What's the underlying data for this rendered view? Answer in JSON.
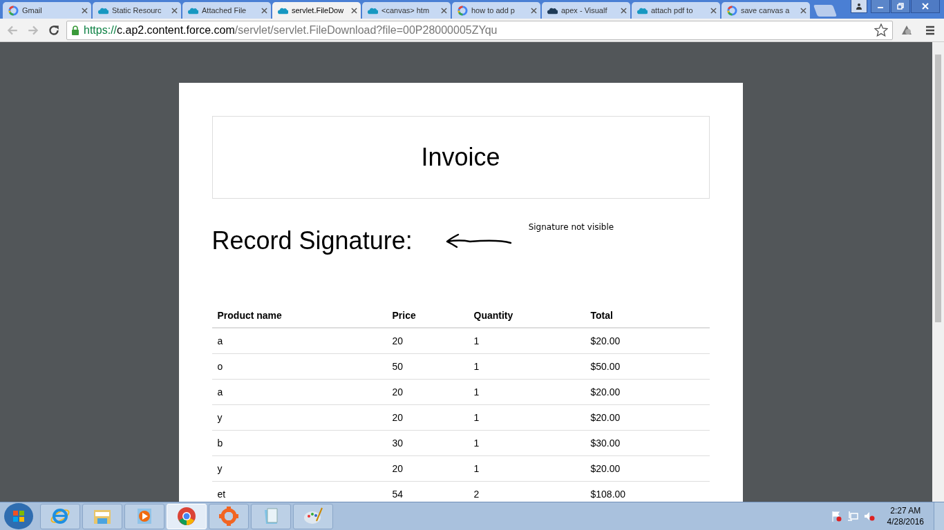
{
  "tabs": [
    {
      "title": "Gmail",
      "kind": "google",
      "selected": false
    },
    {
      "title": "Static Resourc",
      "kind": "salesforce",
      "selected": false
    },
    {
      "title": "Attached File",
      "kind": "salesforce",
      "selected": false
    },
    {
      "title": "servlet.FileDow",
      "kind": "salesforce",
      "selected": true
    },
    {
      "title": "<canvas> htm",
      "kind": "salesforce",
      "selected": false
    },
    {
      "title": "how to add p",
      "kind": "google",
      "selected": false
    },
    {
      "title": "apex - Visualf",
      "kind": "cloud",
      "selected": false
    },
    {
      "title": "attach pdf to",
      "kind": "salesforce",
      "selected": false
    },
    {
      "title": "save canvas a",
      "kind": "google",
      "selected": false
    }
  ],
  "address": {
    "secure_part": "https://",
    "host": "c.ap2.content.force.com",
    "path": "/servlet/servlet.FileDownload?file=00P28000005ZYqu"
  },
  "document": {
    "title": "Invoice",
    "signature_label": "Record Signature:",
    "note": "Signature not visible",
    "table": {
      "columns": [
        "Product name",
        "Price",
        "Quantity",
        "Total"
      ],
      "rows": [
        [
          "a",
          "20",
          "1",
          "$20.00"
        ],
        [
          "o",
          "50",
          "1",
          "$50.00"
        ],
        [
          "a",
          "20",
          "1",
          "$20.00"
        ],
        [
          "y",
          "20",
          "1",
          "$20.00"
        ],
        [
          "b",
          "30",
          "1",
          "$30.00"
        ],
        [
          "y",
          "20",
          "1",
          "$20.00"
        ],
        [
          "et",
          "54",
          "2",
          "$108.00"
        ]
      ]
    }
  },
  "taskbar": {
    "apps": [
      {
        "kind": "ie",
        "selected": false
      },
      {
        "kind": "folder",
        "selected": false
      },
      {
        "kind": "media",
        "selected": false
      },
      {
        "kind": "chrome",
        "selected": true
      },
      {
        "kind": "gear",
        "selected": false
      },
      {
        "kind": "notepad",
        "selected": false
      },
      {
        "kind": "paint",
        "selected": false
      }
    ],
    "time": "2:27 AM",
    "date": "4/28/2016"
  }
}
